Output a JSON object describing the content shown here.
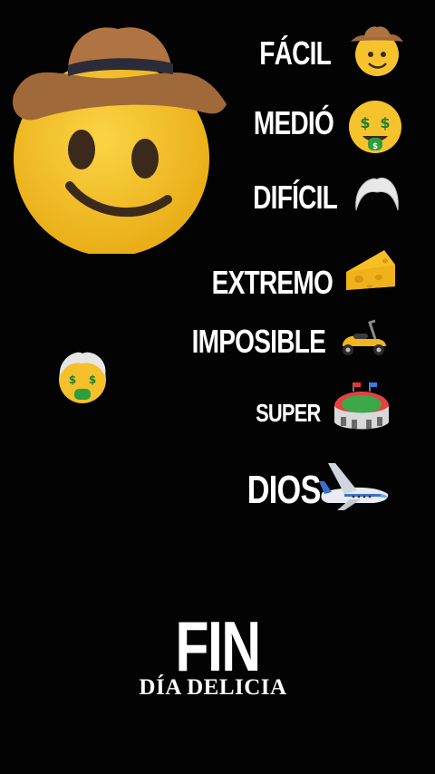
{
  "levels": [
    {
      "label": "FÁCIL",
      "icon": "cowboy-face-icon"
    },
    {
      "label": "MEDIÓ",
      "icon": "money-mouth-face-icon"
    },
    {
      "label": "DIFÍCIL",
      "icon": "white-hair-icon"
    },
    {
      "label": "EXTREMO",
      "icon": "cheese-icon"
    },
    {
      "label": "IMPOSIBLE",
      "icon": "scooter-icon"
    },
    {
      "label": "SUPER",
      "icon": "stadium-icon"
    },
    {
      "label": "DIOS",
      "icon": "airplane-icon"
    }
  ],
  "ending": {
    "title": "FIN",
    "subtitle": "DÍA DELICIA"
  },
  "colors": {
    "background": "#030303",
    "text": "#ffffff",
    "emoji_yellow": "#f7c52b",
    "hat_brown": "#9b6437",
    "money_green": "#2e9e3c"
  }
}
